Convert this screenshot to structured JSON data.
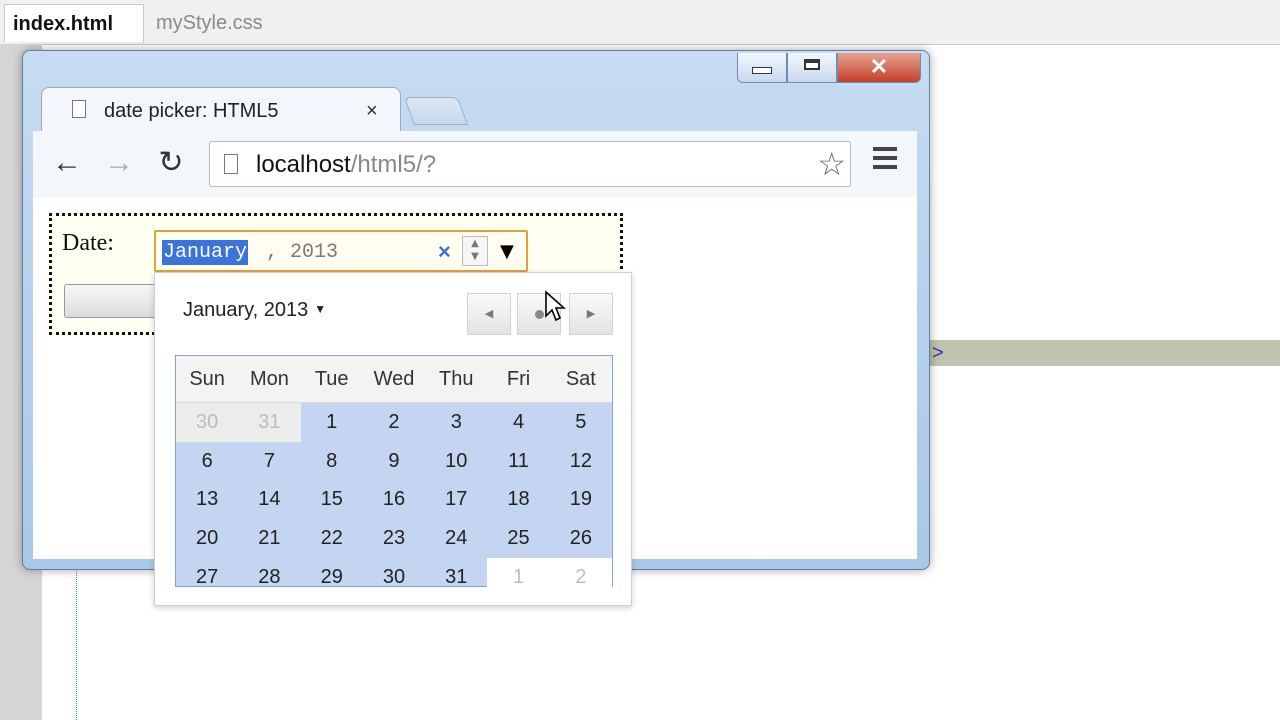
{
  "editor": {
    "tabs": [
      {
        "label": "index.html",
        "active": true
      },
      {
        "label": "myStyle.css",
        "active": false
      }
    ],
    "highlight_glyph": ">"
  },
  "browser": {
    "tab": {
      "title": "date picker: HTML5",
      "close": "×"
    },
    "window_controls": {
      "close": "✕"
    },
    "nav": {
      "back": "←",
      "forward": "→",
      "reload": "↻"
    },
    "address": {
      "host": "localhost",
      "path": "/html5/?"
    },
    "star": "☆"
  },
  "page": {
    "date_label": "Date:",
    "date_input": {
      "month": "January",
      "rest": ", 2013",
      "clear": "×",
      "spin_up": "▲",
      "spin_down": "▼",
      "dropdown": "▼"
    }
  },
  "calendar": {
    "month_title": "January, 2013",
    "title_caret": "▼",
    "nav": {
      "prev": "◀",
      "next": "▶"
    },
    "weekdays": [
      "Sun",
      "Mon",
      "Tue",
      "Wed",
      "Thu",
      "Fri",
      "Sat"
    ],
    "weeks": [
      [
        "30",
        "31",
        "1",
        "2",
        "3",
        "4",
        "5"
      ],
      [
        "6",
        "7",
        "8",
        "9",
        "10",
        "11",
        "12"
      ],
      [
        "13",
        "14",
        "15",
        "16",
        "17",
        "18",
        "19"
      ],
      [
        "20",
        "21",
        "22",
        "23",
        "24",
        "25",
        "26"
      ],
      [
        "27",
        "28",
        "29",
        "30",
        "31",
        "1",
        "2"
      ]
    ]
  }
}
